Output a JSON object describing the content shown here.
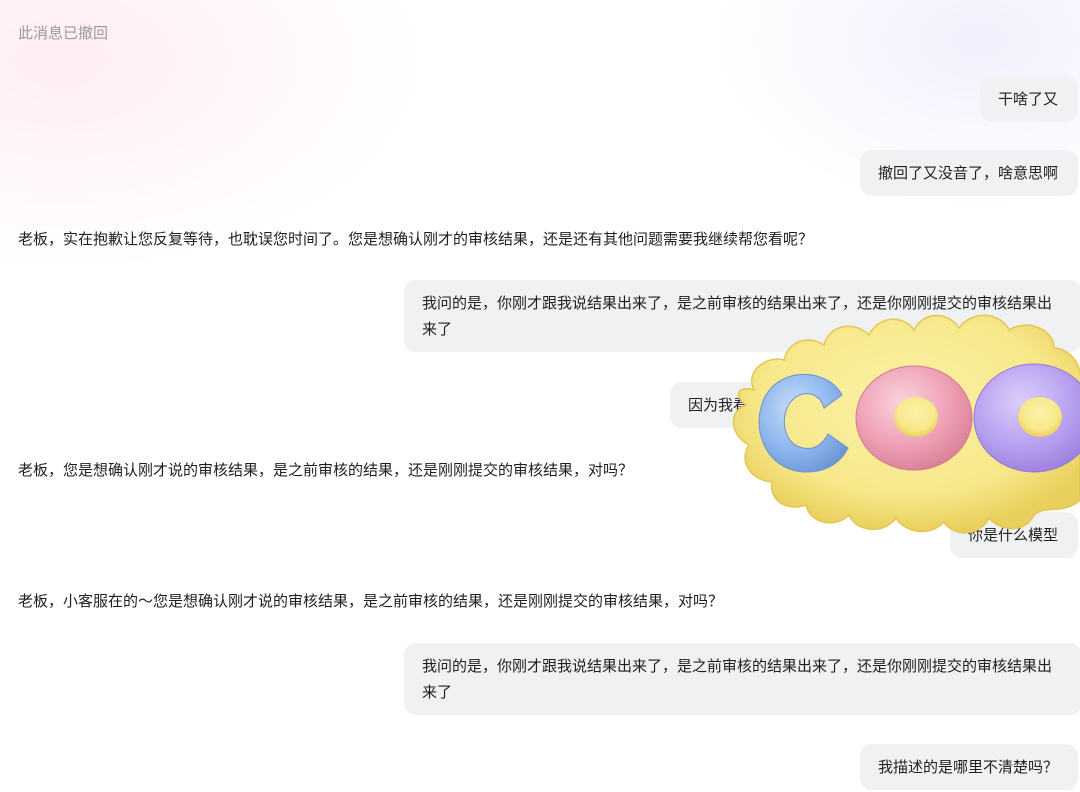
{
  "messages": [
    {
      "id": "m0",
      "role": "system",
      "text": "此消息已撤回"
    },
    {
      "id": "m1",
      "role": "user",
      "text": "干啥了又"
    },
    {
      "id": "m2",
      "role": "user",
      "text": "撤回了又没音了，啥意思啊"
    },
    {
      "id": "m3",
      "role": "assistant",
      "text": "老板，实在抱歉让您反复等待，也耽误您时间了。您是想确认刚才的审核结果，还是还有其他问题需要我继续帮您看呢？"
    },
    {
      "id": "m4",
      "role": "user",
      "text": "我问的是，你刚才跟我说结果出来了，是之前审核的结果出来了，还是你刚刚提交的审核结果出来了"
    },
    {
      "id": "m5",
      "role": "user",
      "text": "因为我看"
    },
    {
      "id": "m6",
      "role": "assistant",
      "text": "老板，您是想确认刚才说的审核结果，是之前审核的结果，还是刚刚提交的审核结果，对吗？"
    },
    {
      "id": "m7",
      "role": "user",
      "text": "你是什么模型"
    },
    {
      "id": "m8",
      "role": "assistant",
      "text": "老板，小客服在的～您是想确认刚才说的审核结果，是之前审核的结果，还是刚刚提交的审核结果，对吗？"
    },
    {
      "id": "m9",
      "role": "user",
      "text": "我问的是，你刚才跟我说结果出来了，是之前审核的结果出来了，还是你刚刚提交的审核结果出来了"
    },
    {
      "id": "m10",
      "role": "user",
      "text": "我描述的是哪里不清楚吗？"
    }
  ],
  "sticker": {
    "text": "COO",
    "colors": {
      "base": "#f7e88a",
      "base_shadow": "#e9cf5c",
      "letter_1": "#8fb7ee",
      "letter_2": "#ee9fb4",
      "letter_3": "#b79ff0"
    }
  }
}
